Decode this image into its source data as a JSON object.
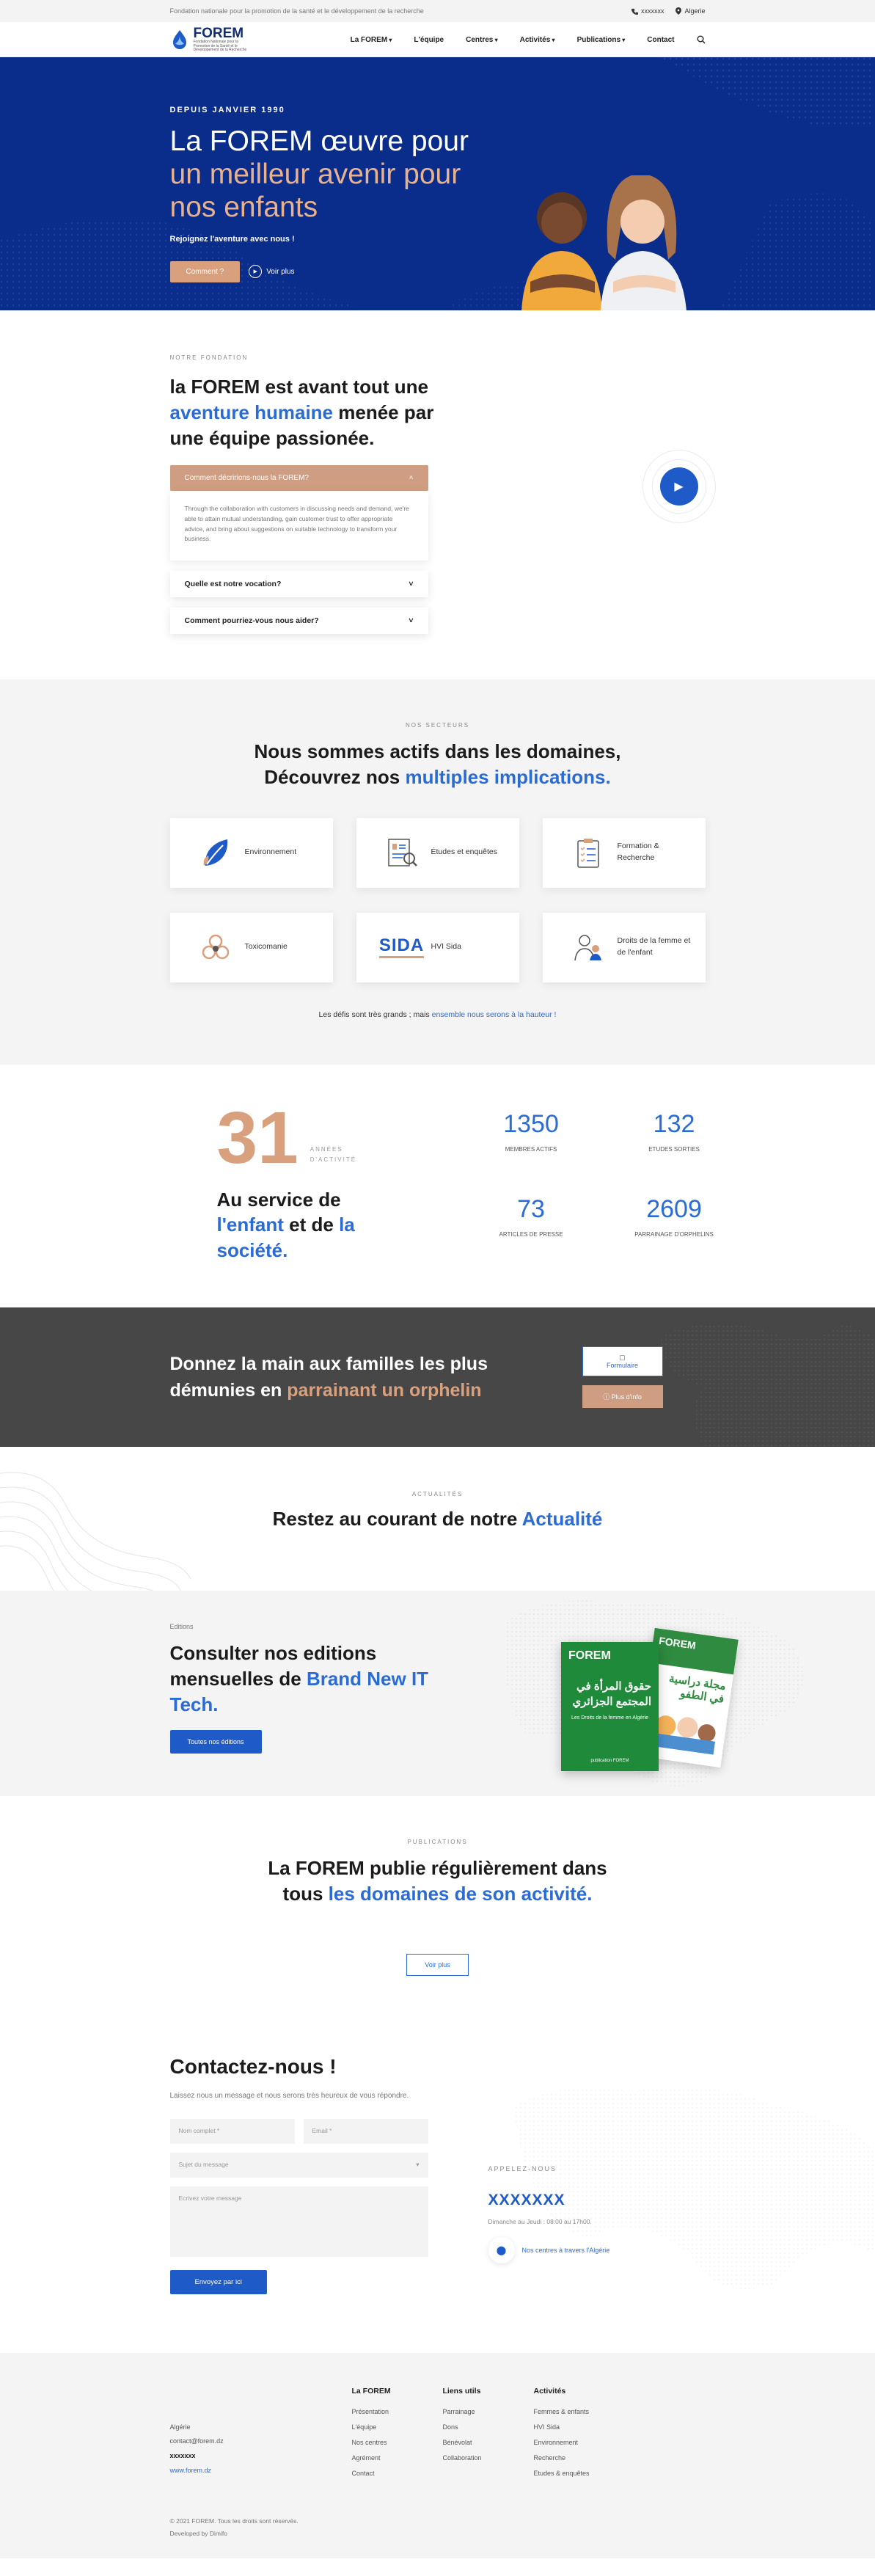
{
  "topbar": {
    "tagline": "Fondation nationale pour la promotion de la santé et le développement de la recherche",
    "phone": "xxxxxxx",
    "location": "Algerie"
  },
  "brand": {
    "name": "FOREM",
    "subtitle": "Fondation Nationale pour la Promotion de la Santé et le Développement de la Recherche"
  },
  "nav": {
    "items": [
      "La FOREM",
      "L'équipe",
      "Centres",
      "Activités",
      "Publications",
      "Contact"
    ]
  },
  "hero": {
    "since": "DEPUIS JANVIER 1990",
    "title_line1": "La FOREM œuvre pour",
    "title_line2": "un meilleur avenir pour",
    "title_line3": "nos enfants",
    "join": "Rejoignez l'aventure avec nous !",
    "cta": "Comment ?",
    "video": "Voir plus"
  },
  "fondation": {
    "kicker": "NOTRE FONDATION",
    "title_a": "la FOREM est avant tout une",
    "title_accent": "aventure humaine",
    "title_b": "menée par une équipe passionée.",
    "faq_open": "Comment décririons-nous la FOREM?",
    "faq_body": "Through the collaboration with customers in discussing needs and demand, we're able to attain mutual understanding, gain customer trust to offer appropriate advice, and bring about suggestions on suitable technology to transform your business.",
    "faq2": "Quelle est notre vocation?",
    "faq3": "Comment pourriez-vous nous aider?"
  },
  "secteurs": {
    "kicker": "NOS SECTEURS",
    "title_line1": "Nous sommes actifs dans les domaines,",
    "title_line2a": "Découvrez nos",
    "title_accent": "multiples implications.",
    "cards": [
      "Environnement",
      "Études et enquêtes",
      "Formation & Recherche",
      "Toxicomanie",
      "HVI Sida",
      "Droits de la femme et de l'enfant"
    ],
    "sida_logo": "SIDA",
    "note_a": "Les défis sont très grands ; mais",
    "note_accent": "ensemble nous serons à la hauteur !"
  },
  "stats": {
    "years": "31",
    "years_label1": "ANNÉES",
    "years_label2": "D'ACTIVITÉ",
    "service_a": "Au service de",
    "service_b": "l'enfant",
    "service_c": "et de",
    "service_d": "la société.",
    "items": [
      {
        "value": "1350",
        "label": "MEMBRES ACTIFS"
      },
      {
        "value": "132",
        "label": "ETUDES SORTIES"
      },
      {
        "value": "73",
        "label": "ARTICLES DE PRESSE"
      },
      {
        "value": "2609",
        "label": "PARRAINAGE D'ORPHELINS"
      }
    ]
  },
  "parrainage": {
    "line1": "Donnez la main aux familles les plus",
    "line2a": "démunies en",
    "line2_accent": "parrainant un orphelin",
    "btn1": "Formulaire",
    "btn2": "Plus d'info"
  },
  "actualite": {
    "kicker": "ACTUALITÉS",
    "title_a": "Restez au courant de notre",
    "title_accent": "Actualité"
  },
  "editions": {
    "kicker": "Editions",
    "title_a": "Consulter nos editions mensuelles de",
    "title_accent": "Brand New IT Tech.",
    "btn": "Toutes nos éditions",
    "book_brand": "FOREM",
    "book1_title": "حقوق المرأة في المجتمع الجزائري",
    "book1_sub": "Les Droits de la femme en Algérie",
    "book2_title": "مجلة دراسية في الطفو",
    "book1_foot": "publication FOREM"
  },
  "publications": {
    "kicker": "PUBLICATIONS",
    "line1": "La FOREM publie régulièrement dans",
    "line2a": "tous",
    "line2_accent": "les domaines de son activité.",
    "btn": "Voir plus"
  },
  "contact": {
    "title": "Contactez-nous !",
    "sub": "Laissez nous un message et nous serons très heureux de vous répondre.",
    "name_ph": "Nom complet *",
    "email_ph": "Email *",
    "subject_ph": "Sujet du message",
    "message_ph": "Ecrivez votre message",
    "send": "Envoyez par ici",
    "call_kicker": "APPELEZ-NOUS",
    "phone": "XXXXXXX",
    "hours": "Dimanche au Jeudi : 08:00 au 17h00.",
    "find": "Nos centres à travers l'Algérie"
  },
  "footer": {
    "address": "Algérie",
    "email": "contact@forem.dz",
    "phone": "xxxxxxx",
    "site": "www.forem.dz",
    "cols": [
      {
        "title": "La FOREM",
        "links": [
          "Présentation",
          "L'équipe",
          "Nos centres",
          "Agrément",
          "Contact"
        ]
      },
      {
        "title": "Liens utils",
        "links": [
          "Parrainage",
          "Dons",
          "Bénévolat",
          "Collaboration"
        ]
      },
      {
        "title": "Activités",
        "links": [
          "Femmes & enfants",
          "HVI Sida",
          "Environnement",
          "Recherche",
          "Etudes & enquêtes"
        ]
      }
    ],
    "copy": "© 2021 FOREM. Tous les droits sont réservés.",
    "dev": "Developed by Dimifo"
  },
  "colors": {
    "navy": "#0a2d8c",
    "blue": "#2b6cd4",
    "tan": "#d9a07d",
    "dark": "#474747"
  },
  "icons": [
    "phone-icon",
    "pin-icon",
    "search-icon",
    "chevron-down-icon",
    "play-icon",
    "leaf-icon",
    "report-icon",
    "checklist-icon",
    "biohazard-icon",
    "women-children-icon",
    "form-icon",
    "info-icon",
    "location-icon"
  ]
}
